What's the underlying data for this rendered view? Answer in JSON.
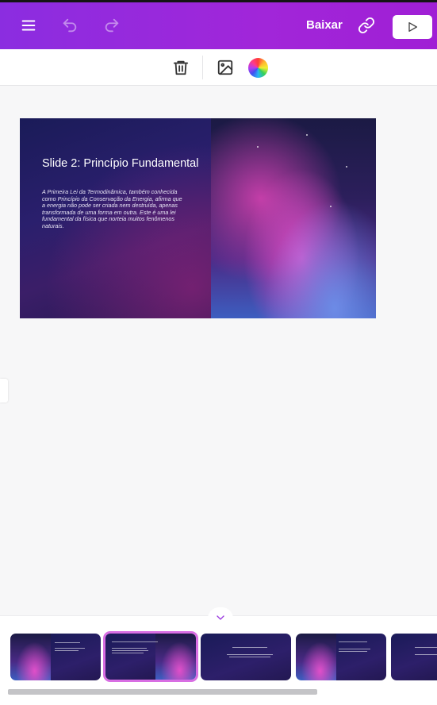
{
  "header": {
    "download_label": "Baixar",
    "icons": [
      "menu-icon",
      "undo-icon",
      "redo-icon",
      "link-icon",
      "play-icon"
    ]
  },
  "toolbar": {
    "icons": [
      "trash-icon",
      "image-icon",
      "color-wheel-icon"
    ]
  },
  "slide": {
    "title": "Slide 2: Princípio Fundamental",
    "body": "A Primeira Lei da Termodinâmica, também conhecida como Princípio da Conservação da Energia, afirma que a energia não pode ser criada nem destruída, apenas transformada de uma forma em outra. Este é uma lei fundamental da física que norteia muitos fenômenos naturais."
  },
  "thumbnails": [
    {
      "index": 1,
      "selected": false
    },
    {
      "index": 2,
      "selected": true
    },
    {
      "index": 3,
      "selected": false
    },
    {
      "index": 4,
      "selected": false
    },
    {
      "index": 5,
      "selected": false
    }
  ],
  "colors": {
    "header_start": "#8b2de0",
    "header_end": "#a01fd5",
    "selection_border": "#d86ee3"
  }
}
